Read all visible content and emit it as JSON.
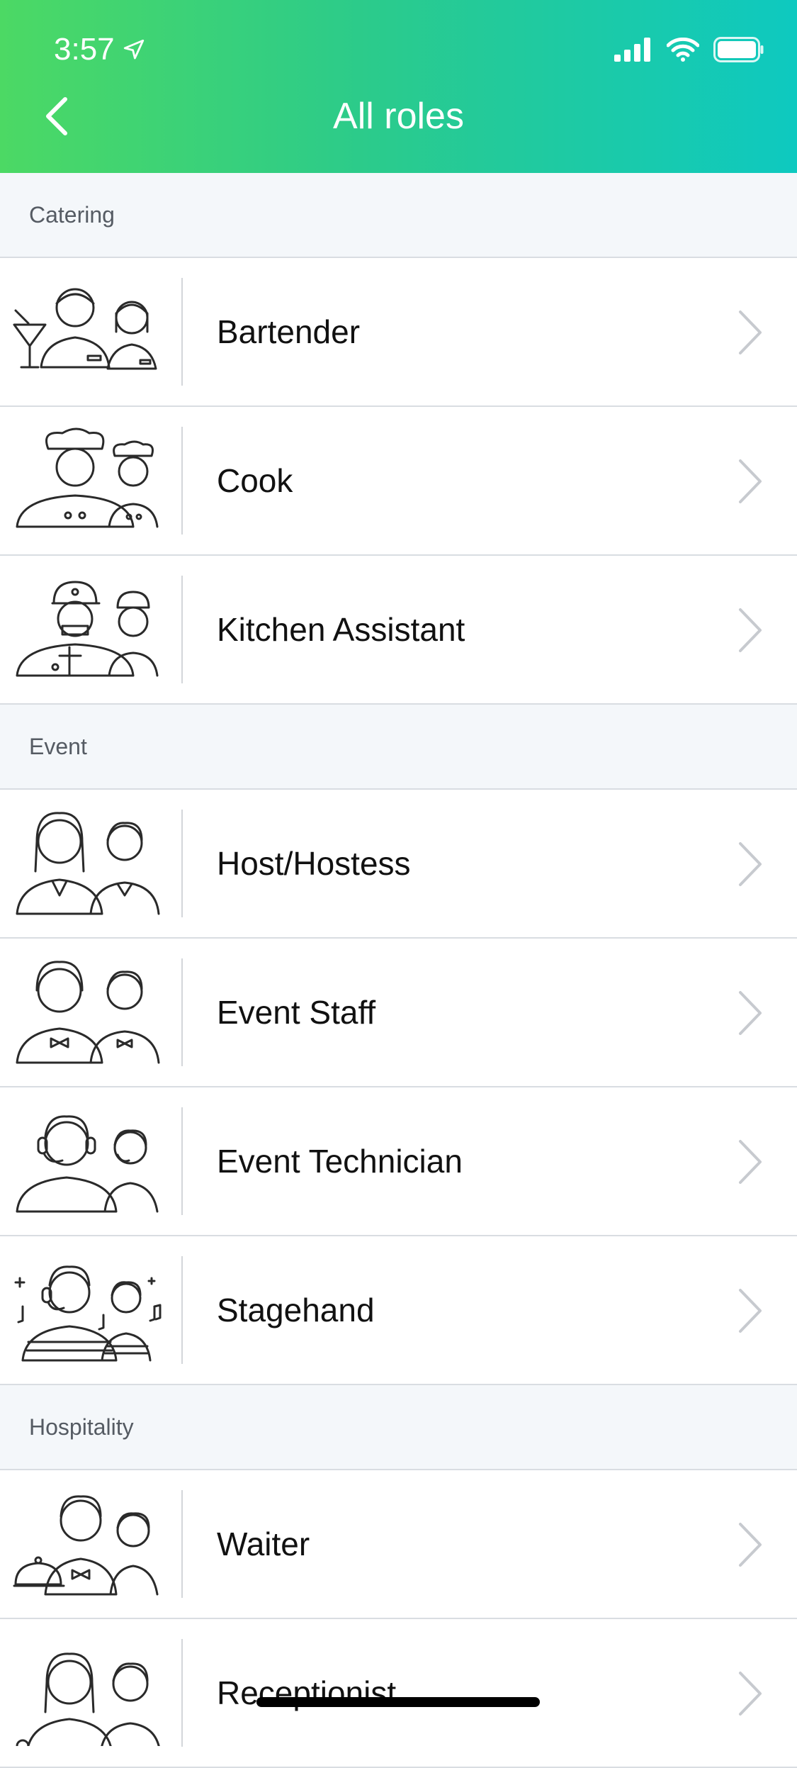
{
  "status_bar": {
    "time": "3:57"
  },
  "header": {
    "title": "All roles"
  },
  "sections": [
    {
      "title": "Catering",
      "items": [
        {
          "label": "Bartender"
        },
        {
          "label": "Cook"
        },
        {
          "label": "Kitchen Assistant"
        }
      ]
    },
    {
      "title": "Event",
      "items": [
        {
          "label": "Host/Hostess"
        },
        {
          "label": "Event Staff"
        },
        {
          "label": "Event Technician"
        },
        {
          "label": "Stagehand"
        }
      ]
    },
    {
      "title": "Hospitality",
      "items": [
        {
          "label": "Waiter"
        },
        {
          "label": "Receptionist"
        }
      ]
    }
  ],
  "icons": {
    "back": "chevron-left-icon",
    "row_chevron": "chevron-right-icon",
    "location": "location-arrow-icon",
    "signal": "cellular-signal-icon",
    "wifi": "wifi-icon",
    "battery": "battery-icon"
  },
  "colors": {
    "header_gradient_start": "#4cd964",
    "header_gradient_end": "#0ec9c0",
    "section_background": "#f4f7fa",
    "chevron": "#c7cacf"
  }
}
